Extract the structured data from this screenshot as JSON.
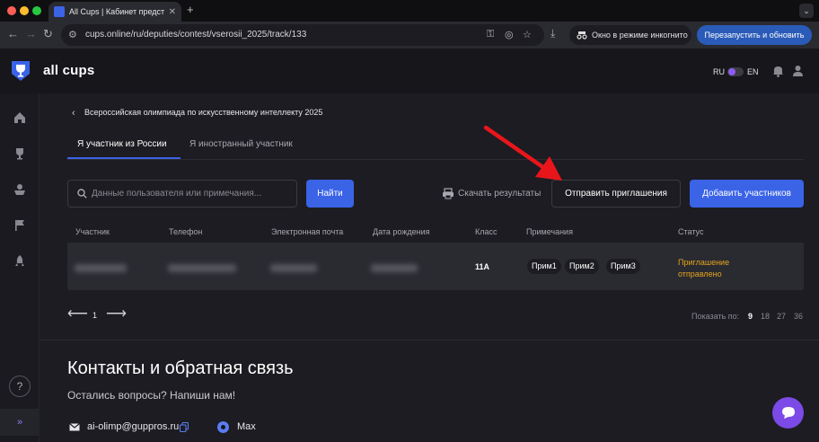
{
  "browser": {
    "tab_title": "All Cups | Кабинет представ",
    "new_tab_label": "+",
    "url": "cups.online/ru/deputies/contest/vserosii_2025/track/133",
    "incognito_label": "Окно в режиме инкогнито",
    "relaunch_label": "Перезапустить и обновить"
  },
  "header": {
    "brand": "all cups",
    "lang_ru": "RU",
    "lang_en": "EN"
  },
  "sidebar": {
    "items": [
      "home-icon",
      "trophy-icon",
      "cup-icon",
      "flag-icon",
      "rocket-icon"
    ],
    "help_label": "?",
    "expand_label": "»"
  },
  "page": {
    "breadcrumb": "Всероссийская олимпиада по искусственному интеллекту 2025",
    "tabs": [
      "Я участник из России",
      "Я иностранный участник"
    ],
    "search_placeholder": "Данные пользователя или примечания...",
    "find_label": "Найти",
    "download_label": "Скачать результаты",
    "invite_label": "Отправить приглашения",
    "add_label": "Добавить участников"
  },
  "table": {
    "headers": [
      "Участник",
      "Телефон",
      "Электронная почта",
      "Дата рождения",
      "Класс",
      "Примечания",
      "Статус"
    ],
    "row": {
      "class": "11А",
      "notes": [
        "Прим1",
        "Прим2",
        "Прим3"
      ],
      "status": "Приглашение отправлено"
    }
  },
  "pagination": {
    "current_page": "1",
    "show_label": "Показать по:",
    "sizes": [
      "9",
      "18",
      "27",
      "36"
    ],
    "selected_size": "9"
  },
  "contacts": {
    "title": "Контакты и обратная связь",
    "subtitle": "Остались вопросы? Напиши нам!",
    "email": "ai-olimp@guppros.ru",
    "max": "Max"
  },
  "colors": {
    "accent": "#3a63e6",
    "status": "#e3a51c",
    "annotation_arrow": "#e8161b"
  }
}
